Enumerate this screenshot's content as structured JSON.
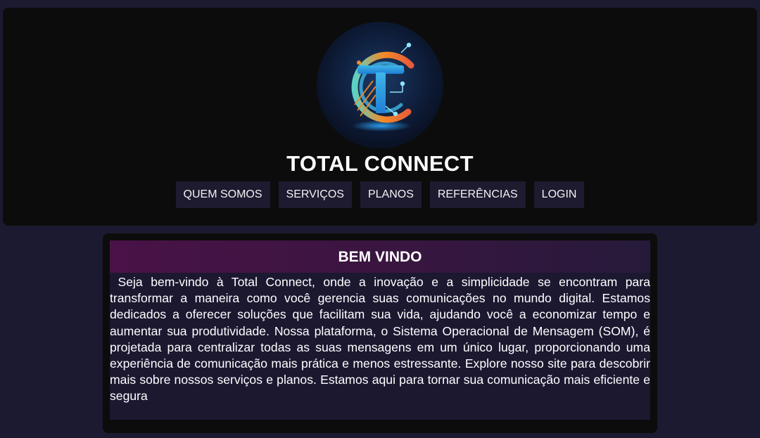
{
  "site": {
    "title": "TOTAL CONNECT"
  },
  "logo": {
    "icon": "tc-monogram-logo",
    "colors": [
      "#f28c28",
      "#3fb6e8",
      "#1f7fd6",
      "#5ad2c4"
    ]
  },
  "nav": {
    "items": [
      {
        "label": "QUEM SOMOS"
      },
      {
        "label": "SERVIÇOS"
      },
      {
        "label": "PLANOS"
      },
      {
        "label": "REFERÊNCIAS"
      },
      {
        "label": "LOGIN"
      }
    ]
  },
  "welcome": {
    "title": "BEM VINDO",
    "text": " Seja bem-vindo à Total Connect, onde a inovação e a simplicidade se encontram para transformar a maneira como você gerencia suas comunicações no mundo digital. Estamos dedicados a oferecer soluções que facilitam sua vida, ajudando você a economizar tempo e aumentar sua produtividade. Nossa plataforma, o Sistema Operacional de Mensagem (SOM), é projetada para centralizar todas as suas mensagens em um único lugar, proporcionando uma experiência de comunicação mais prática e menos estressante. Explore nosso site para descobrir mais sobre nossos serviços e planos. Estamos aqui para tornar sua comunicação mais eficiente e segura"
  },
  "colors": {
    "page_background": "#1c1a30",
    "header_background": "#0c0c0c",
    "nav_button": "#1e1a30",
    "welcome_bar_start": "#4a1248",
    "welcome_bar_end": "#261a3a"
  }
}
